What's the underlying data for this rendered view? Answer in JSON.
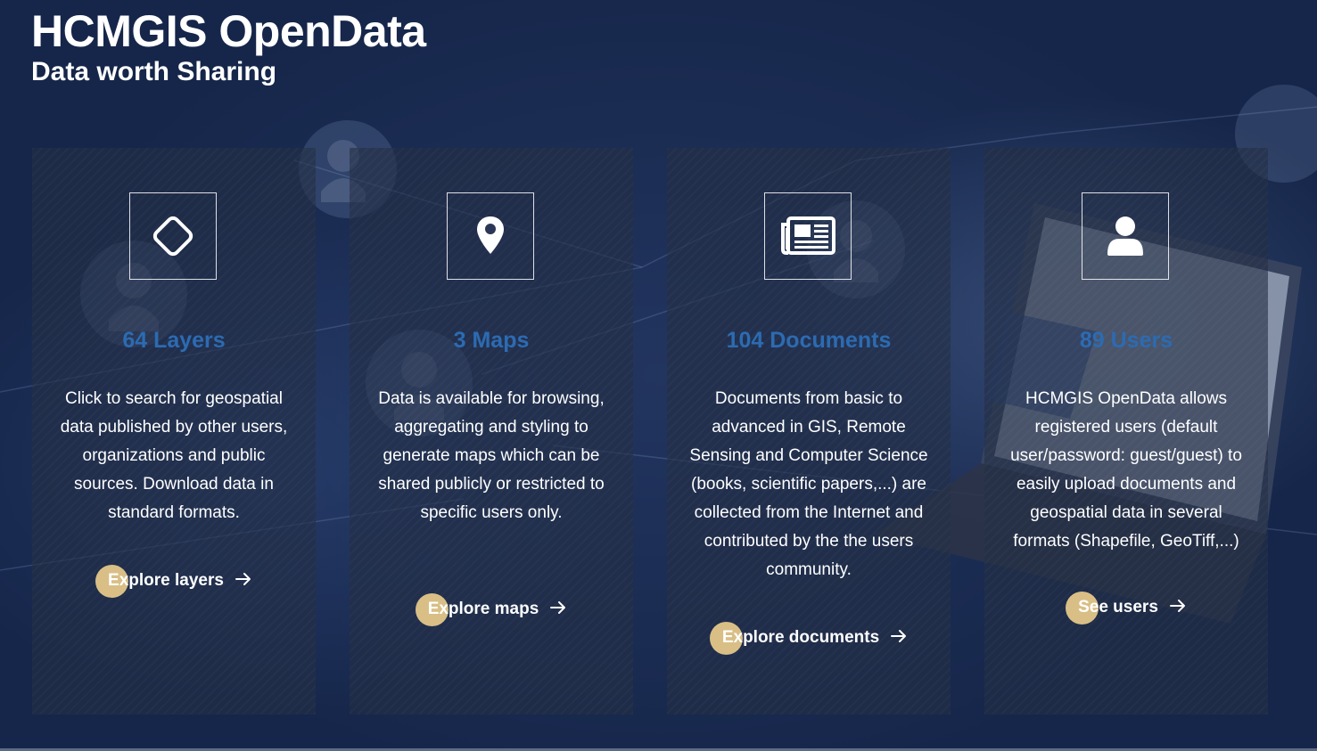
{
  "hero": {
    "title": "HCMGIS OpenData",
    "subtitle": "Data worth Sharing"
  },
  "cards": [
    {
      "icon": "layers-diamond-icon",
      "count_label": "64 Layers",
      "description": "Click to search for geospatial data published by other users, organizations and public sources. Download data in standard formats.",
      "link_label": "Explore layers",
      "link_icon": "arrow-right-icon"
    },
    {
      "icon": "map-pin-icon",
      "count_label": "3 Maps",
      "description": "Data is available for browsing, aggregating and styling to generate maps which can be shared publicly or restricted to specific users only.",
      "link_label": "Explore maps",
      "link_icon": "arrow-right-icon"
    },
    {
      "icon": "newspaper-icon",
      "count_label": "104 Documents",
      "description": "Documents from basic to advanced in GIS, Remote Sensing and Computer Science (books, scientific papers,...) are collected from the Internet and contributed by the the users community.",
      "link_label": "Explore documents",
      "link_icon": "arrow-right-icon"
    },
    {
      "icon": "user-icon",
      "count_label": "89 Users",
      "description": "HCMGIS OpenData allows registered users (default user/password: guest/guest) to easily upload documents and geospatial data in several formats (Shapefile, GeoTiff,...)",
      "link_label": "See users",
      "link_icon": "arrow-right-icon"
    }
  ],
  "colors": {
    "background": "#1a2a4c",
    "card_background": "#242e46",
    "count_text": "#2c6bb2",
    "link_dot": "#d9bf86",
    "text": "#ffffff"
  }
}
